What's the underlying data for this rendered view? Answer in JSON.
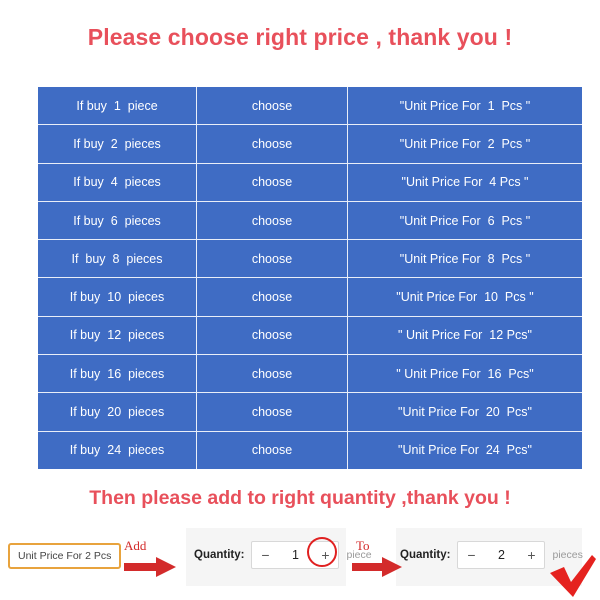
{
  "headings": {
    "top": "Please choose right price , thank you !",
    "bottom": "Then please add to right quantity ,thank you !"
  },
  "colors": {
    "heading_red": "#e8505b",
    "table_blue": "#3f6cc4",
    "table_grid": "#e9eef8",
    "badge_border": "#e8a33d",
    "arrow_red": "#d32b2b",
    "highlight_red": "#e02020",
    "panel_gray": "#f5f5f5"
  },
  "price_table": {
    "rows": [
      {
        "qty": "If buy  1  piece",
        "action": "choose",
        "price": "\"Unit Price For  1  Pcs \""
      },
      {
        "qty": "If buy  2  pieces",
        "action": "choose",
        "price": "\"Unit Price For  2  Pcs \""
      },
      {
        "qty": "If buy  4  pieces",
        "action": "choose",
        "price": "\"Unit Price For  4 Pcs \""
      },
      {
        "qty": "If buy  6  pieces",
        "action": "choose",
        "price": "\"Unit Price For  6  Pcs \""
      },
      {
        "qty": "If  buy  8  pieces",
        "action": "choose",
        "price": "\"Unit Price For  8  Pcs \""
      },
      {
        "qty": "If buy  10  pieces",
        "action": "choose",
        "price": "\"Unit Price For  10  Pcs \""
      },
      {
        "qty": "If buy  12  pieces",
        "action": "choose",
        "price": "\" Unit Price For  12 Pcs\""
      },
      {
        "qty": "If buy  16  pieces",
        "action": "choose",
        "price": "\" Unit Price For  16  Pcs\""
      },
      {
        "qty": "If buy  20  pieces",
        "action": "choose",
        "price": "\"Unit Price For  20  Pcs\""
      },
      {
        "qty": "If buy  24  pieces",
        "action": "choose",
        "price": "\"Unit Price For  24  Pcs\""
      }
    ]
  },
  "flow": {
    "price_badge": "Unit Price For 2 Pcs",
    "arrow_add_label": "Add",
    "arrow_to_label": "To",
    "step_before": {
      "label": "Quantity:",
      "minus": "−",
      "value": "1",
      "plus": "+",
      "unit": "piece"
    },
    "step_after": {
      "label": "Quantity:",
      "minus": "−",
      "value": "2",
      "plus": "+",
      "unit": "pieces"
    }
  }
}
